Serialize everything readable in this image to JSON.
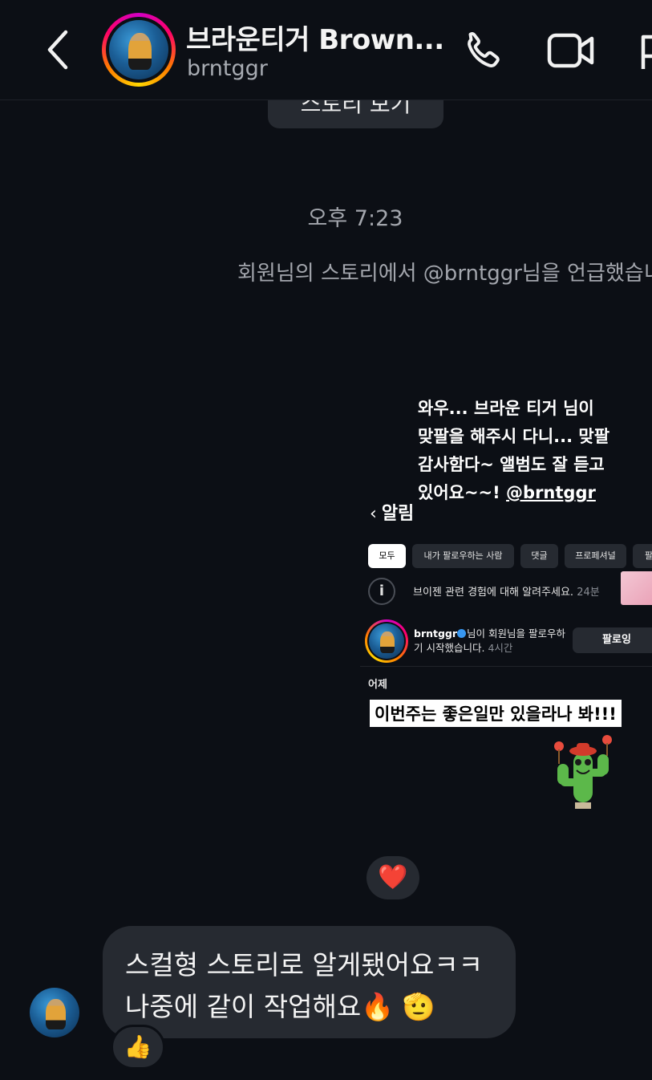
{
  "header": {
    "contact_name": "브라운티거 Brown...",
    "contact_handle": "brntggr"
  },
  "thread": {
    "view_story_button": "스토리 보기",
    "timestamp": "오후 7:23",
    "mention_notice": "회원님의 스토리에서 @brntggr님을 언급했습니다",
    "story": {
      "caption": "와우... 브라운 티거 님이\n맞팔을 해주시 다니... 맞팔\n감사함다~ 앨범도 잘 듣고\n있어요~~!",
      "caption_mention": "@brntggr",
      "notifications_title": "알림",
      "filters": [
        "모두",
        "내가 팔로우하는 사람",
        "댓글",
        "프로페셔널",
        "팔"
      ],
      "notification_1": {
        "text": "브이젠 관련 경험에 대해 알려주세요.",
        "time": "24분"
      },
      "notification_2": {
        "user": "brntggr",
        "text": "님이 회원님을 팔로우하기 시작했습니다.",
        "time": "4시간",
        "button": "팔로잉"
      },
      "section_label": "어제",
      "sticker_text": "이번주는 좋은일만 있을라나 봐!!!"
    },
    "story_reaction": "❤️",
    "message": {
      "line1": "스컬형 스토리로 알게됐어요ㅋㅋ",
      "line2": "나중에 같이 작업해요🔥 🫡",
      "reaction": "👍"
    }
  }
}
